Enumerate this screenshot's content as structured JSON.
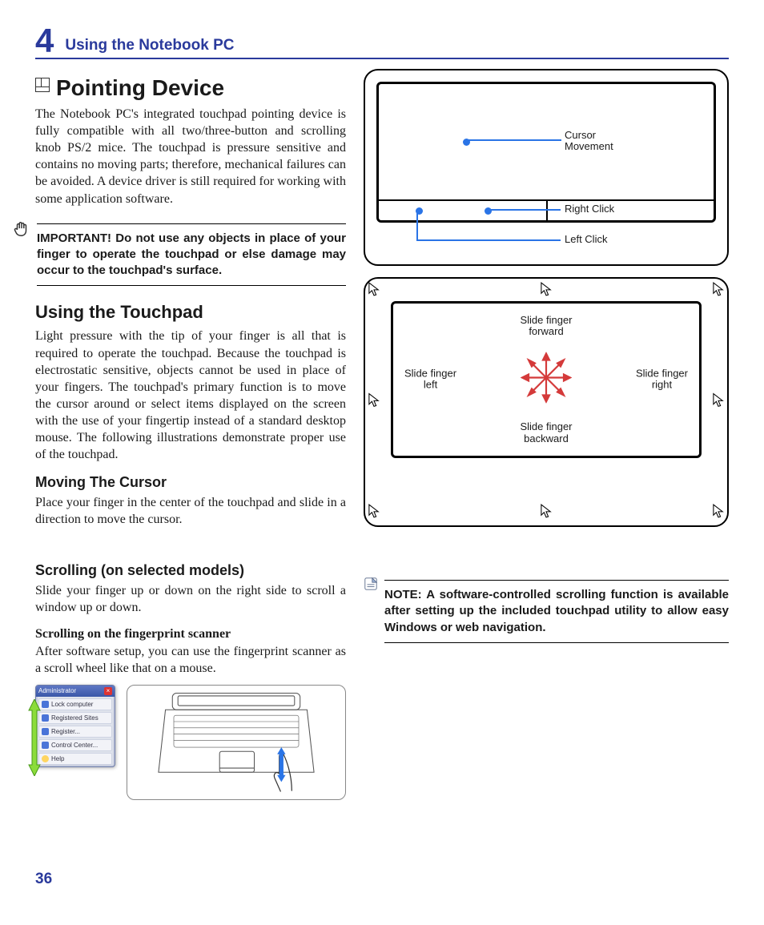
{
  "chapter": {
    "number": "4",
    "title": "Using the Notebook PC"
  },
  "page_number": "36",
  "section": {
    "title": "Pointing Device",
    "intro": "The Notebook PC's integrated touchpad pointing device is fully compatible with all two/three-button and scrolling knob PS/2 mice. The touchpad is pressure sensitive and contains no moving parts; therefore, mechanical failures can be avoided. A device driver is still required for working with some application software.",
    "important": "IMPORTANT! Do not use any objects in place of your finger to operate the touchpad or else damage may occur to the touchpad's surface."
  },
  "touchpad": {
    "title": "Using the Touchpad",
    "para": "Light pressure with the tip of your finger is all that is required to operate the touchpad. Because the touchpad is electrostatic sensitive, objects cannot be used in place of your fingers. The touchpad's primary function is to move the cursor around or select items displayed on the screen with the use of your fingertip instead of a standard desktop mouse. The following illustrations demonstrate proper use of the touchpad.",
    "moving_title": "Moving The Cursor",
    "moving_para": "Place your finger in the center of the touchpad and slide in a direction to move the cursor."
  },
  "scrolling": {
    "title": "Scrolling (on selected models)",
    "para": "Slide your finger up or down on the right side to scroll a window up or down.",
    "fp_title": "Scrolling on the fingerprint scanner",
    "fp_para": "After software setup, you can use the fingerprint scanner as a scroll wheel like that on a mouse."
  },
  "note": "NOTE: A software-controlled scrolling function is available after setting up the included touchpad utility to allow easy Windows or web navigation.",
  "fig1_labels": {
    "cursor": "Cursor\nMovement",
    "right": "Right Click",
    "left": "Left Click"
  },
  "fig2_labels": {
    "fwd": "Slide finger\nforward",
    "back": "Slide finger\nbackward",
    "left": "Slide finger\nleft",
    "right": "Slide finger\nright"
  },
  "admin_menu": {
    "title": "Administrator",
    "items": [
      "Lock computer",
      "Registered Sites",
      "Register...",
      "Control Center...",
      "Help"
    ]
  }
}
